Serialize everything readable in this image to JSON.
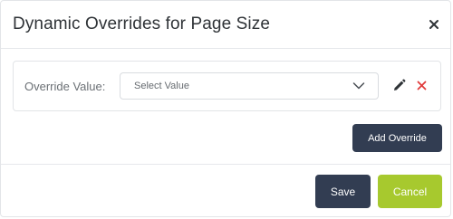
{
  "dialog": {
    "title": "Dynamic Overrides for Page Size"
  },
  "override": {
    "label": "Override Value:",
    "select_placeholder": "Select Value"
  },
  "buttons": {
    "add_override": "Add Override",
    "save": "Save",
    "cancel": "Cancel"
  },
  "colors": {
    "primary": "#323d52",
    "accent": "#a7c92e",
    "delete": "#e03b3b"
  },
  "icons": {
    "close": "close-icon",
    "chevron": "chevron-down-icon",
    "edit": "pencil-icon",
    "delete": "delete-x-icon"
  }
}
